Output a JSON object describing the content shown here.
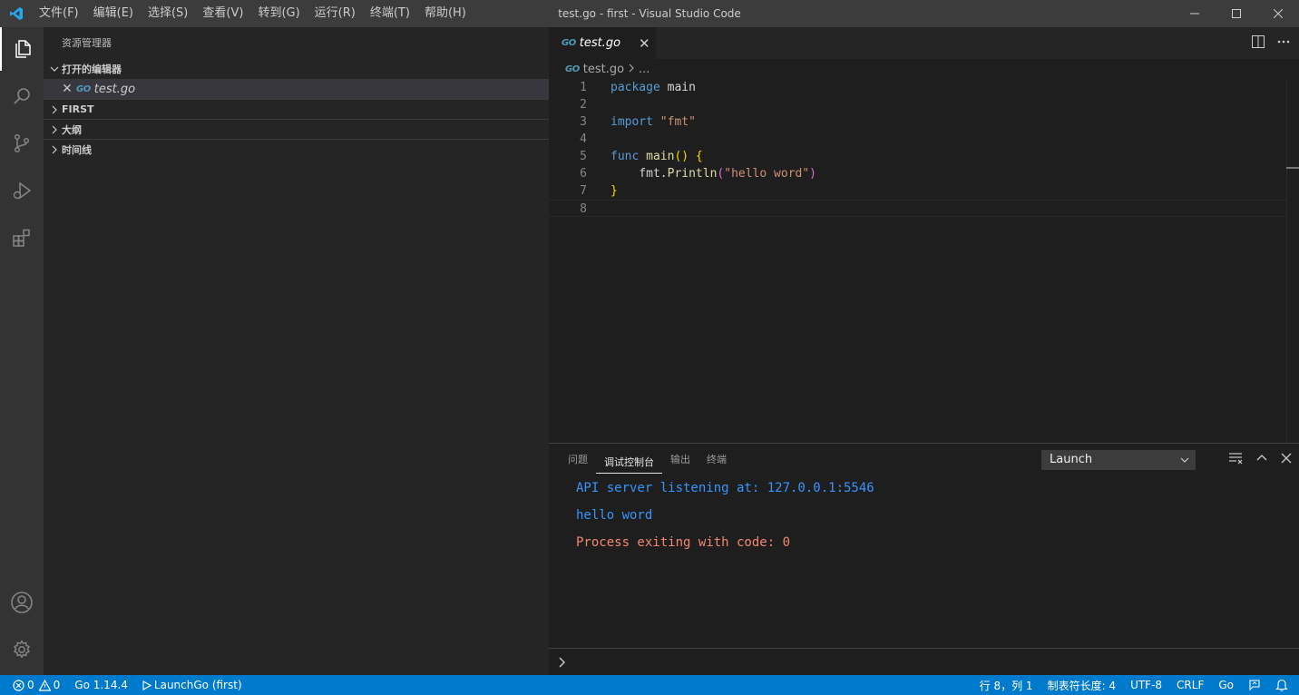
{
  "window": {
    "title": "test.go - first - Visual Studio Code"
  },
  "menu": [
    "文件(F)",
    "编辑(E)",
    "选择(S)",
    "查看(V)",
    "转到(G)",
    "运行(R)",
    "终端(T)",
    "帮助(H)"
  ],
  "activity_bar": {
    "items": [
      "files-icon",
      "search-icon",
      "source-control-icon",
      "run-debug-icon",
      "extensions-icon"
    ],
    "bottom": [
      "account-icon",
      "gear-icon"
    ],
    "active": "files-icon"
  },
  "sidebar": {
    "title": "资源管理器",
    "open_editors_label": "打开的编辑器",
    "open_editors": [
      {
        "icon": "GO",
        "name": "test.go"
      }
    ],
    "sections": [
      "FIRST",
      "大纲",
      "时间线"
    ]
  },
  "editor": {
    "tab": {
      "icon": "GO",
      "name": "test.go"
    },
    "breadcrumb": {
      "file": "test.go",
      "rest": "..."
    },
    "line_numbers": [
      "1",
      "2",
      "3",
      "4",
      "5",
      "6",
      "7",
      "8"
    ],
    "code": {
      "l1_kw": "package",
      "l1_rest": " main",
      "l3_kw": "import",
      "l3_str": " \"fmt\"",
      "l5_kw": "func",
      "l5_fn": " main",
      "l5_paren": "()",
      "l5_brace": " {",
      "l6_indent": "    fmt.",
      "l6_fn": "Println",
      "l6_open": "(",
      "l6_str": "\"hello word\"",
      "l6_close": ")",
      "l7_brace": "}"
    }
  },
  "panel": {
    "tabs": [
      "问题",
      "调试控制台",
      "输出",
      "终端"
    ],
    "active_tab": "调试控制台",
    "config_select": "Launch",
    "console": [
      {
        "text": "API server listening at: 127.0.0.1:5546",
        "color": "#3794ff"
      },
      {
        "text": "hello word",
        "color": "#3794ff"
      },
      {
        "text": "Process exiting with code: 0",
        "color": "#f48771"
      }
    ]
  },
  "statusbar": {
    "errors": "0",
    "warnings": "0",
    "go_version": "Go 1.14.4",
    "launch": "LaunchGo (first)",
    "position": "行 8，列 1",
    "indent": "制表符长度: 4",
    "encoding": "UTF-8",
    "eol": "CRLF",
    "language": "Go"
  },
  "colors": {
    "accent": "#007acc",
    "go_icon": "#519aba"
  }
}
